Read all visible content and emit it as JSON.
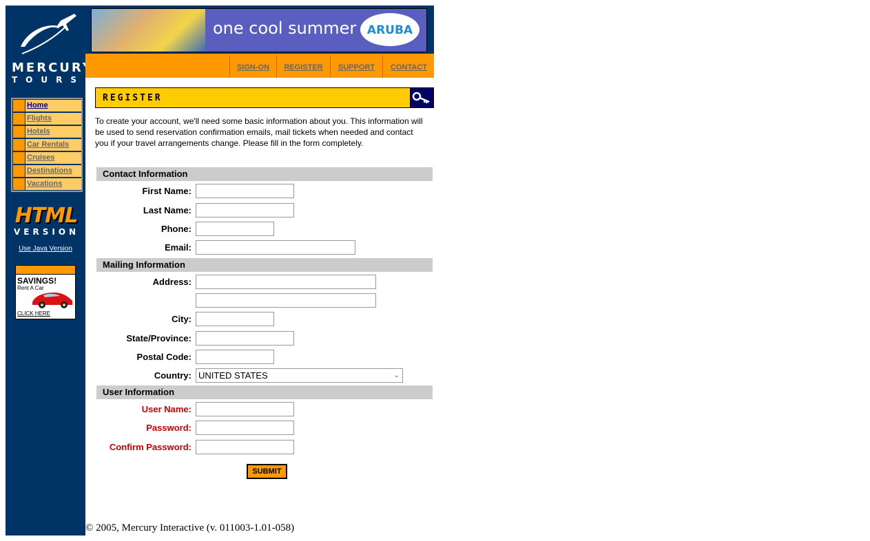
{
  "brand": {
    "name_line1": "MERCURY",
    "name_line2": "TOURS"
  },
  "banner": {
    "text": "one cool summer",
    "badge": "ARUBA"
  },
  "top_nav": [
    {
      "label": "SIGN-ON"
    },
    {
      "label": "REGISTER"
    },
    {
      "label": "SUPPORT"
    },
    {
      "label": "CONTACT"
    }
  ],
  "side_nav": [
    {
      "label": "Home"
    },
    {
      "label": "Flights"
    },
    {
      "label": "Hotels"
    },
    {
      "label": "Car Rentals"
    },
    {
      "label": "Cruises"
    },
    {
      "label": "Destinations"
    },
    {
      "label": "Vacations"
    }
  ],
  "html_version": {
    "title": "HTML",
    "subtitle": "VERSION",
    "java_link": "Use Java Version"
  },
  "ad": {
    "headline": "SAVINGS!",
    "sub": "Rent A Car",
    "cta": "CLICK HERE"
  },
  "page": {
    "title": "REGISTER",
    "intro": "To create your account, we'll need some basic information about you. This information will be used to send reservation confirmation emails, mail tickets when needed and contact you if your travel arrangements change. Please fill in the form completely."
  },
  "sections": {
    "contact": "Contact Information",
    "mailing": "Mailing Information",
    "user": "User Information"
  },
  "fields": {
    "first_name": {
      "label": "First Name:",
      "value": ""
    },
    "last_name": {
      "label": "Last Name:",
      "value": ""
    },
    "phone": {
      "label": "Phone:",
      "value": ""
    },
    "email": {
      "label": "Email:",
      "value": ""
    },
    "address": {
      "label": "Address:",
      "value": "",
      "value2": ""
    },
    "city": {
      "label": "City:",
      "value": ""
    },
    "state": {
      "label": "State/Province:",
      "value": ""
    },
    "postal": {
      "label": "Postal Code:",
      "value": ""
    },
    "country": {
      "label": "Country:",
      "value": "UNITED STATES"
    },
    "user_name": {
      "label": "User Name:",
      "value": ""
    },
    "password": {
      "label": "Password:",
      "value": ""
    },
    "confirm_password": {
      "label": "Confirm Password:",
      "value": ""
    }
  },
  "submit_label": "SUBMIT",
  "footer": "© 2005, Mercury Interactive (v. 011003-1.01-058)",
  "colors": {
    "navy": "#003366",
    "orange": "#ff9900",
    "yellow": "#ffcc00",
    "required_red": "#cc0000"
  }
}
